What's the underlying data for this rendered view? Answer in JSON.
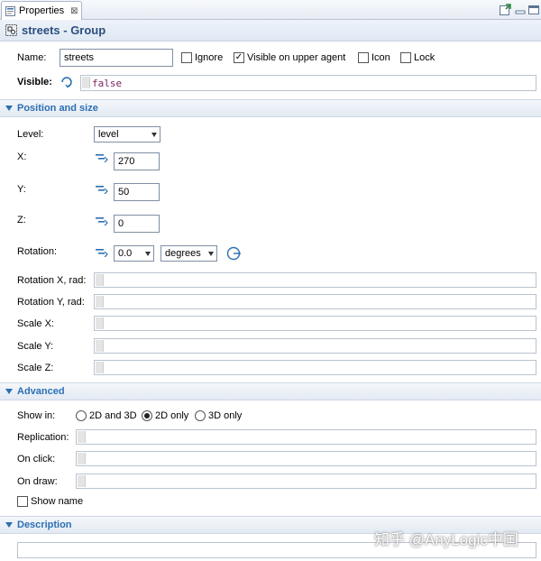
{
  "tab": {
    "label": "Properties",
    "close_glyph": "⊠"
  },
  "header": {
    "title": "streets - Group"
  },
  "name_row": {
    "label": "Name:",
    "value": "streets"
  },
  "checkboxes": [
    {
      "label": "Ignore",
      "checked": false
    },
    {
      "label": "Visible on upper agent",
      "checked": true
    },
    {
      "label": "Icon",
      "checked": false
    },
    {
      "label": "Lock",
      "checked": false
    }
  ],
  "visible": {
    "label": "Visible:",
    "value": "false"
  },
  "sections": {
    "position": "Position and size",
    "advanced": "Advanced",
    "description": "Description"
  },
  "position": {
    "level": {
      "label": "Level:",
      "value": "level"
    },
    "x": {
      "label": "X:",
      "value": "270"
    },
    "y": {
      "label": "Y:",
      "value": "50"
    },
    "z": {
      "label": "Z:",
      "value": "0"
    },
    "rotation": {
      "label": "Rotation:",
      "value": "0.0",
      "unit": "degrees"
    },
    "rotation_x": {
      "label": "Rotation X, rad:"
    },
    "rotation_y": {
      "label": "Rotation Y, rad:"
    },
    "scale_x": {
      "label": "Scale X:"
    },
    "scale_y": {
      "label": "Scale Y:"
    },
    "scale_z": {
      "label": "Scale Z:"
    }
  },
  "advanced": {
    "show_in": {
      "label": "Show in:",
      "options": [
        "2D and 3D",
        "2D only",
        "3D only"
      ],
      "selected": "2D only"
    },
    "replication": {
      "label": "Replication:"
    },
    "on_click": {
      "label": "On click:"
    },
    "on_draw": {
      "label": "On draw:"
    },
    "show_name": {
      "label": "Show name",
      "checked": false
    }
  },
  "watermark": "知乎 @AnyLogic中国",
  "colors": {
    "accent": "#2c6fb3",
    "header_text": "#2a4f7e",
    "code": "#7a1f5c"
  }
}
